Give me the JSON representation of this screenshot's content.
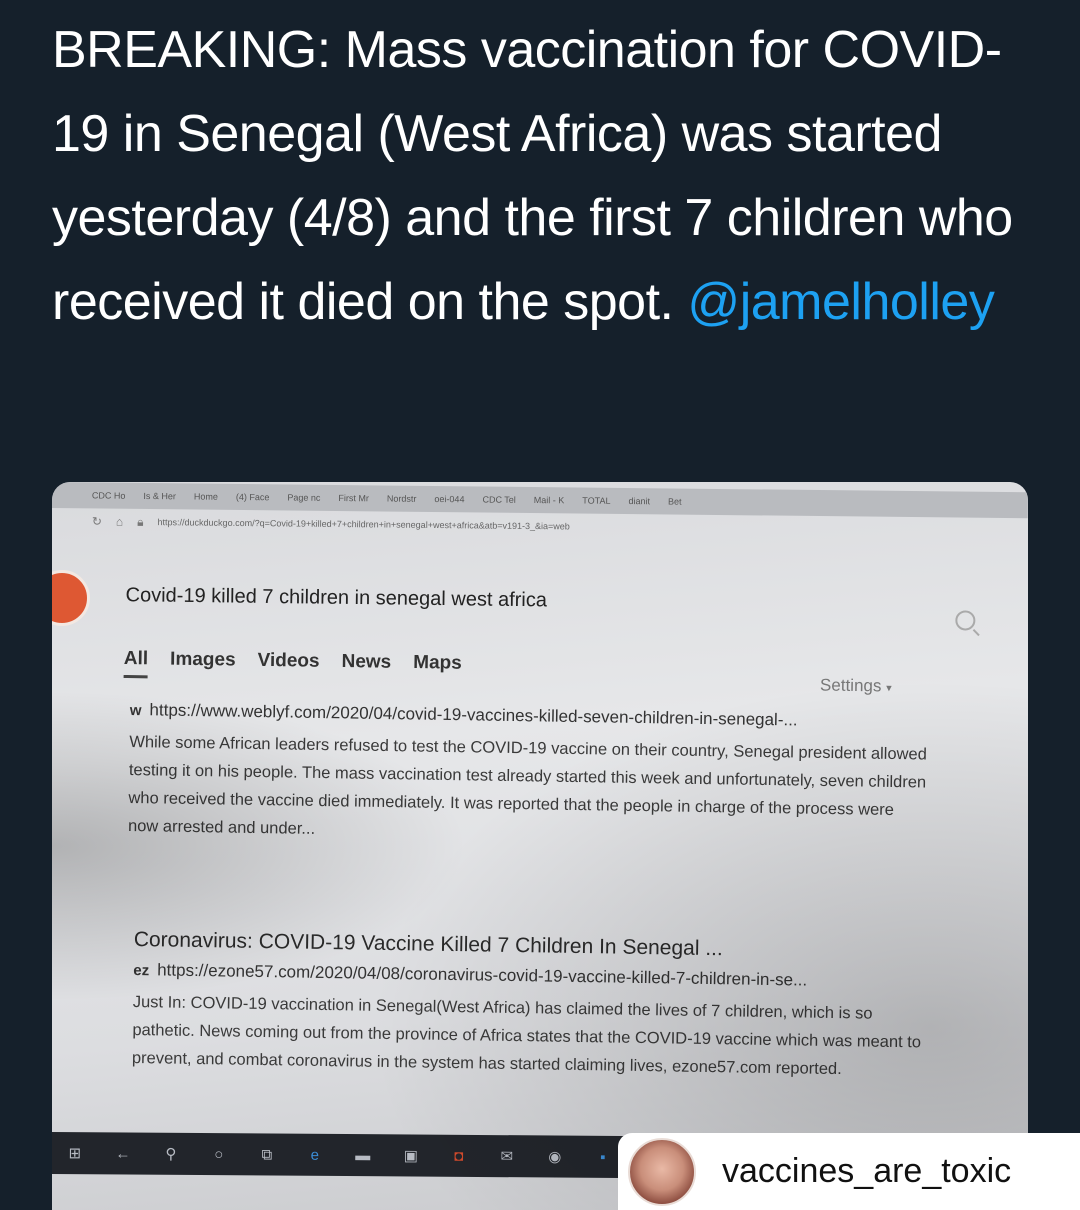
{
  "tweet": {
    "text": "BREAKING: Mass vaccination for COVID-19 in Senegal (West Africa) was started yesterday (4/8) and the first 7 children who received it died on the spot.",
    "mention": "@jamelholley"
  },
  "screenshot": {
    "bookmarks": [
      "CDC Ho",
      "Is & Her",
      "Home",
      "(4) Face",
      "Page nc",
      "First Mr",
      "Nordstr",
      "oei-044",
      "CDC Tel",
      "Mail - K",
      "TOTAL",
      "dianit",
      "Bet"
    ],
    "address_url": "https://duckduckgo.com/?q=Covid-19+killed+7+children+in+senegal+west+africa&atb=v191-3_&ia=web",
    "search_query": "Covid-19 killed 7 children in senegal west africa",
    "tabs": [
      "All",
      "Images",
      "Videos",
      "News",
      "Maps"
    ],
    "settings_label": "Settings",
    "results": [
      {
        "favicon": "w",
        "url": "https://www.weblyf.com/2020/04/covid-19-vaccines-killed-seven-children-in-senegal-...",
        "snippet": "While some African leaders refused to test the COVID-19 vaccine on their country, Senegal president allowed testing it on his people. The mass vaccination test already started this week and unfortunately, seven children who received the vaccine died immediately. It was reported that the people in charge of the process were now arrested and under..."
      },
      {
        "title": "Coronavirus: COVID-19 Vaccine Killed 7 Children In Senegal ...",
        "favicon": "ez",
        "url": "https://ezone57.com/2020/04/08/coronavirus-covid-19-vaccine-killed-7-children-in-se...",
        "snippet": "Just In: COVID-19 vaccination in Senegal(West Africa) has claimed the lives of 7 children, which is so pathetic. News coming out from the province of Africa states that the COVID-19 vaccine which was meant to prevent, and combat coronavirus in the system has started claiming lives, ezone57.com reported."
      }
    ]
  },
  "repost": {
    "handle": "vaccines_are_toxic"
  }
}
